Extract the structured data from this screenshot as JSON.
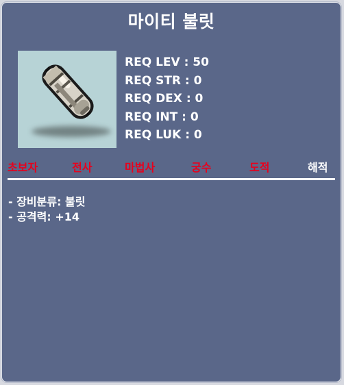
{
  "item": {
    "name": "마이티 불릿",
    "icon": "bullet-icon",
    "requirements": [
      "REQ LEV : 50",
      "REQ STR : 0",
      "REQ DEX : 0",
      "REQ INT : 0",
      "REQ LUK : 0"
    ],
    "jobs": [
      {
        "label": "초보자",
        "color": "#e8001c"
      },
      {
        "label": "전사",
        "color": "#e8001c"
      },
      {
        "label": "마법사",
        "color": "#e8001c"
      },
      {
        "label": "궁수",
        "color": "#e8001c"
      },
      {
        "label": "도적",
        "color": "#e8001c"
      },
      {
        "label": "해적",
        "color": "#ffffff"
      }
    ],
    "description": [
      "- 장비분류: 불릿",
      "- 공격력: +14"
    ]
  },
  "colors": {
    "panel": "#5a6789",
    "icon_background": "#b7d3d6",
    "unavailable_job": "#e8001c",
    "available_job": "#ffffff"
  }
}
